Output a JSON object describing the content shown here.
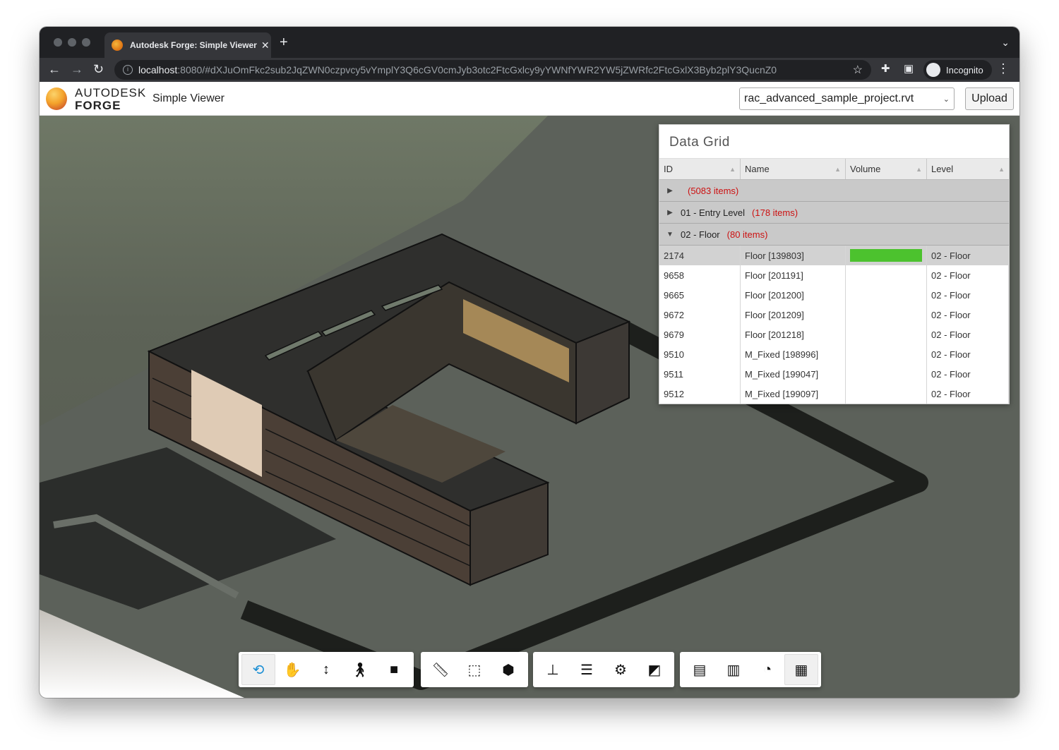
{
  "browser": {
    "tab_title": "Autodesk Forge: Simple Viewer",
    "tab_close": "✕",
    "new_tab": "+",
    "url_host": "localhost",
    "url_rest": ":8080/#dXJuOmFkc2sub2JqZWN0czpvcy5vYmplY3Q6cGV0cmJyb3otc2FtcGxlcy9yYWNfYWR2YW5jZWRfc2FtcGxlX3Byb2plY3QucnZ0",
    "profile_label": "Incognito"
  },
  "app": {
    "logo_line1": "AUTODESK",
    "logo_line2": "FORGE",
    "title": "Simple Viewer",
    "model_select_value": "rac_advanced_sample_project.rvt",
    "upload_label": "Upload"
  },
  "grid": {
    "title": "Data Grid",
    "columns": [
      "ID",
      "Name",
      "Volume",
      "Level"
    ],
    "groups": [
      {
        "label": "",
        "count": "(5083 items)",
        "expanded": false
      },
      {
        "label": "01 - Entry Level",
        "count": "(178 items)",
        "expanded": false
      },
      {
        "label": "02 - Floor",
        "count": "(80 items)",
        "expanded": true
      }
    ],
    "rows": [
      {
        "id": "2174",
        "name": "Floor [139803]",
        "volume_fraction": 1.0,
        "level": "02 - Floor"
      },
      {
        "id": "9658",
        "name": "Floor [201191]",
        "volume_fraction": 0,
        "level": "02 - Floor"
      },
      {
        "id": "9665",
        "name": "Floor [201200]",
        "volume_fraction": 0,
        "level": "02 - Floor"
      },
      {
        "id": "9672",
        "name": "Floor [201209]",
        "volume_fraction": 0,
        "level": "02 - Floor"
      },
      {
        "id": "9679",
        "name": "Floor [201218]",
        "volume_fraction": 0,
        "level": "02 - Floor"
      },
      {
        "id": "9510",
        "name": "M_Fixed [198996]",
        "volume_fraction": 0,
        "level": "02 - Floor"
      },
      {
        "id": "9511",
        "name": "M_Fixed [199047]",
        "volume_fraction": 0,
        "level": "02 - Floor"
      },
      {
        "id": "9512",
        "name": "M_Fixed [199097]",
        "volume_fraction": 0,
        "level": "02 - Floor"
      }
    ],
    "bar_color": "#4cc22e",
    "count_color": "#cc1111"
  },
  "toolbar_groups": [
    [
      "orbit-icon",
      "pan-icon",
      "zoom-icon",
      "first-person-icon",
      "camera-icon"
    ],
    [
      "measure-icon",
      "section-icon",
      "explode-icon"
    ],
    [
      "model-browser-icon",
      "properties-icon",
      "settings-icon",
      "fullscreen-icon"
    ],
    [
      "document-icon",
      "bar-chart-icon",
      "pie-chart-icon",
      "data-grid-icon"
    ]
  ]
}
